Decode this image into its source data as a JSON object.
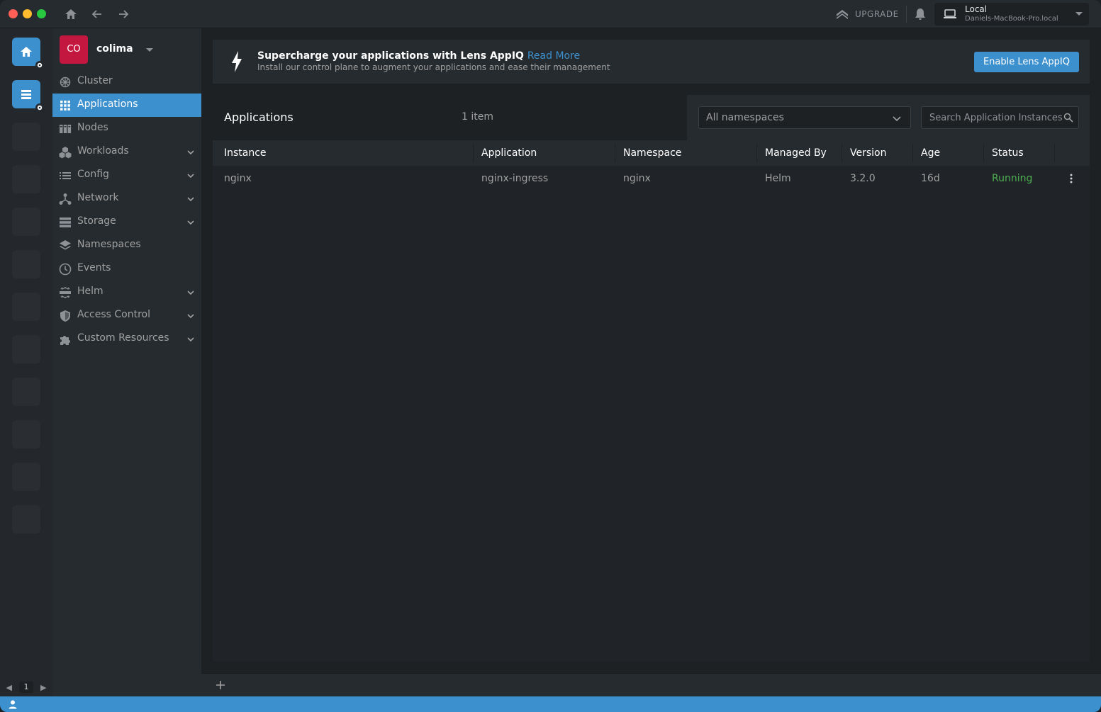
{
  "titlebar": {
    "upgrade_label": "UPGRADE",
    "cluster": {
      "name": "Local",
      "host": "Daniels-MacBook-Pro.local"
    }
  },
  "hotbar": {
    "page": "1"
  },
  "sidebar": {
    "cluster_initials": "CO",
    "cluster_name": "colima",
    "items": [
      {
        "label": "Cluster",
        "icon": "cluster-icon",
        "expandable": false,
        "active": false
      },
      {
        "label": "Applications",
        "icon": "apps-grid-icon",
        "expandable": false,
        "active": true
      },
      {
        "label": "Nodes",
        "icon": "nodes-icon",
        "expandable": false,
        "active": false
      },
      {
        "label": "Workloads",
        "icon": "workloads-icon",
        "expandable": true,
        "active": false
      },
      {
        "label": "Config",
        "icon": "config-icon",
        "expandable": true,
        "active": false
      },
      {
        "label": "Network",
        "icon": "network-icon",
        "expandable": true,
        "active": false
      },
      {
        "label": "Storage",
        "icon": "storage-icon",
        "expandable": true,
        "active": false
      },
      {
        "label": "Namespaces",
        "icon": "namespaces-icon",
        "expandable": false,
        "active": false
      },
      {
        "label": "Events",
        "icon": "events-clock-icon",
        "expandable": false,
        "active": false
      },
      {
        "label": "Helm",
        "icon": "helm-icon",
        "expandable": true,
        "active": false
      },
      {
        "label": "Access Control",
        "icon": "shield-icon",
        "expandable": true,
        "active": false
      },
      {
        "label": "Custom Resources",
        "icon": "puzzle-icon",
        "expandable": true,
        "active": false
      }
    ]
  },
  "banner": {
    "title": "Supercharge your applications with Lens AppIQ",
    "link": "Read More",
    "subtitle": "Install our control plane to augment your applications and ease their management",
    "button": "Enable Lens AppIQ"
  },
  "panel": {
    "title": "Applications",
    "count": "1 item",
    "namespace_select": "All namespaces",
    "search_placeholder": "Search Application Instances..."
  },
  "table": {
    "columns": [
      "Instance",
      "Application",
      "Namespace",
      "Managed By",
      "Version",
      "Age",
      "Status"
    ],
    "rows": [
      {
        "instance": "nginx",
        "application": "nginx-ingress",
        "namespace": "nginx",
        "managed_by": "Helm",
        "version": "3.2.0",
        "age": "16d",
        "status": "Running"
      }
    ]
  },
  "colors": {
    "accent": "#3d90ce",
    "running": "#4caf50",
    "cluster_avatar": "#c4173f"
  }
}
